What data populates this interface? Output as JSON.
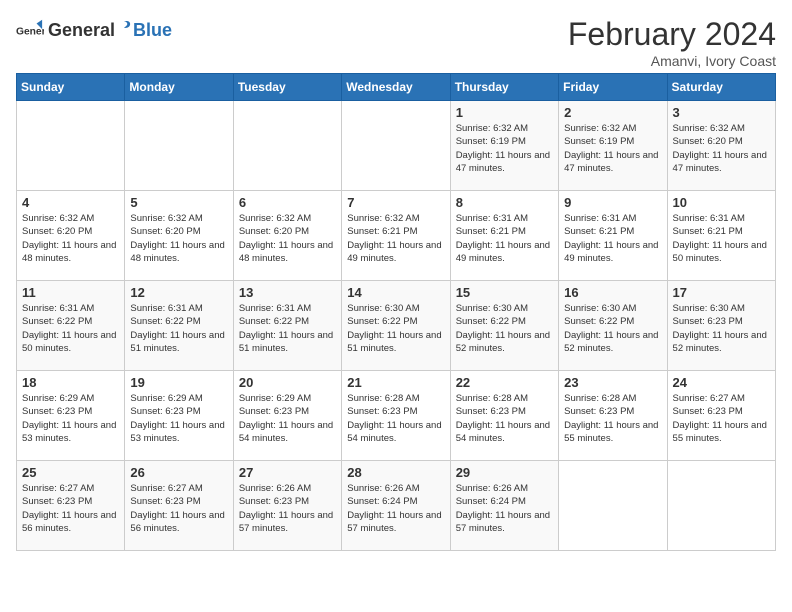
{
  "header": {
    "logo_general": "General",
    "logo_blue": "Blue",
    "title": "February 2024",
    "subtitle": "Amanvi, Ivory Coast"
  },
  "days_of_week": [
    "Sunday",
    "Monday",
    "Tuesday",
    "Wednesday",
    "Thursday",
    "Friday",
    "Saturday"
  ],
  "weeks": [
    [
      {
        "day": "",
        "info": ""
      },
      {
        "day": "",
        "info": ""
      },
      {
        "day": "",
        "info": ""
      },
      {
        "day": "",
        "info": ""
      },
      {
        "day": "1",
        "info": "Sunrise: 6:32 AM\nSunset: 6:19 PM\nDaylight: 11 hours and 47 minutes."
      },
      {
        "day": "2",
        "info": "Sunrise: 6:32 AM\nSunset: 6:19 PM\nDaylight: 11 hours and 47 minutes."
      },
      {
        "day": "3",
        "info": "Sunrise: 6:32 AM\nSunset: 6:20 PM\nDaylight: 11 hours and 47 minutes."
      }
    ],
    [
      {
        "day": "4",
        "info": "Sunrise: 6:32 AM\nSunset: 6:20 PM\nDaylight: 11 hours and 48 minutes."
      },
      {
        "day": "5",
        "info": "Sunrise: 6:32 AM\nSunset: 6:20 PM\nDaylight: 11 hours and 48 minutes."
      },
      {
        "day": "6",
        "info": "Sunrise: 6:32 AM\nSunset: 6:20 PM\nDaylight: 11 hours and 48 minutes."
      },
      {
        "day": "7",
        "info": "Sunrise: 6:32 AM\nSunset: 6:21 PM\nDaylight: 11 hours and 49 minutes."
      },
      {
        "day": "8",
        "info": "Sunrise: 6:31 AM\nSunset: 6:21 PM\nDaylight: 11 hours and 49 minutes."
      },
      {
        "day": "9",
        "info": "Sunrise: 6:31 AM\nSunset: 6:21 PM\nDaylight: 11 hours and 49 minutes."
      },
      {
        "day": "10",
        "info": "Sunrise: 6:31 AM\nSunset: 6:21 PM\nDaylight: 11 hours and 50 minutes."
      }
    ],
    [
      {
        "day": "11",
        "info": "Sunrise: 6:31 AM\nSunset: 6:22 PM\nDaylight: 11 hours and 50 minutes."
      },
      {
        "day": "12",
        "info": "Sunrise: 6:31 AM\nSunset: 6:22 PM\nDaylight: 11 hours and 51 minutes."
      },
      {
        "day": "13",
        "info": "Sunrise: 6:31 AM\nSunset: 6:22 PM\nDaylight: 11 hours and 51 minutes."
      },
      {
        "day": "14",
        "info": "Sunrise: 6:30 AM\nSunset: 6:22 PM\nDaylight: 11 hours and 51 minutes."
      },
      {
        "day": "15",
        "info": "Sunrise: 6:30 AM\nSunset: 6:22 PM\nDaylight: 11 hours and 52 minutes."
      },
      {
        "day": "16",
        "info": "Sunrise: 6:30 AM\nSunset: 6:22 PM\nDaylight: 11 hours and 52 minutes."
      },
      {
        "day": "17",
        "info": "Sunrise: 6:30 AM\nSunset: 6:23 PM\nDaylight: 11 hours and 52 minutes."
      }
    ],
    [
      {
        "day": "18",
        "info": "Sunrise: 6:29 AM\nSunset: 6:23 PM\nDaylight: 11 hours and 53 minutes."
      },
      {
        "day": "19",
        "info": "Sunrise: 6:29 AM\nSunset: 6:23 PM\nDaylight: 11 hours and 53 minutes."
      },
      {
        "day": "20",
        "info": "Sunrise: 6:29 AM\nSunset: 6:23 PM\nDaylight: 11 hours and 54 minutes."
      },
      {
        "day": "21",
        "info": "Sunrise: 6:28 AM\nSunset: 6:23 PM\nDaylight: 11 hours and 54 minutes."
      },
      {
        "day": "22",
        "info": "Sunrise: 6:28 AM\nSunset: 6:23 PM\nDaylight: 11 hours and 54 minutes."
      },
      {
        "day": "23",
        "info": "Sunrise: 6:28 AM\nSunset: 6:23 PM\nDaylight: 11 hours and 55 minutes."
      },
      {
        "day": "24",
        "info": "Sunrise: 6:27 AM\nSunset: 6:23 PM\nDaylight: 11 hours and 55 minutes."
      }
    ],
    [
      {
        "day": "25",
        "info": "Sunrise: 6:27 AM\nSunset: 6:23 PM\nDaylight: 11 hours and 56 minutes."
      },
      {
        "day": "26",
        "info": "Sunrise: 6:27 AM\nSunset: 6:23 PM\nDaylight: 11 hours and 56 minutes."
      },
      {
        "day": "27",
        "info": "Sunrise: 6:26 AM\nSunset: 6:23 PM\nDaylight: 11 hours and 57 minutes."
      },
      {
        "day": "28",
        "info": "Sunrise: 6:26 AM\nSunset: 6:24 PM\nDaylight: 11 hours and 57 minutes."
      },
      {
        "day": "29",
        "info": "Sunrise: 6:26 AM\nSunset: 6:24 PM\nDaylight: 11 hours and 57 minutes."
      },
      {
        "day": "",
        "info": ""
      },
      {
        "day": "",
        "info": ""
      }
    ]
  ]
}
